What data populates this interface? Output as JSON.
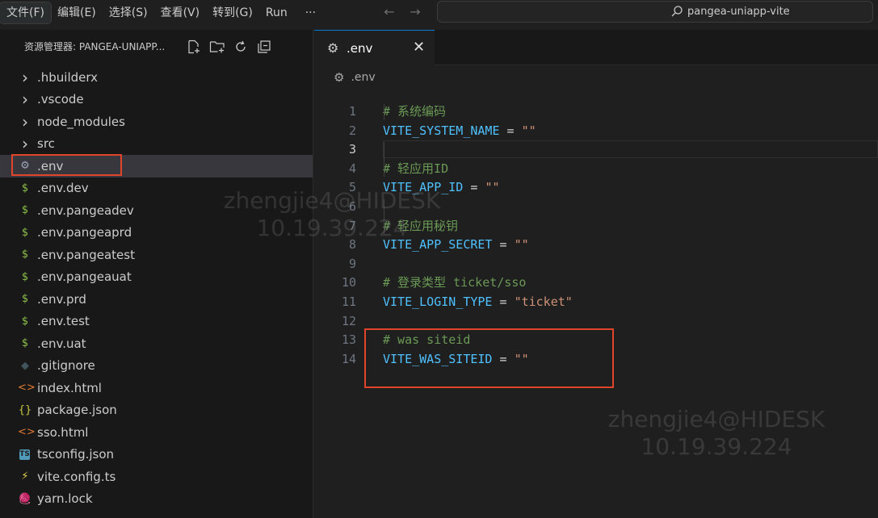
{
  "menu": {
    "items": [
      "文件(F)",
      "编辑(E)",
      "选择(S)",
      "查看(V)",
      "转到(G)",
      "Run"
    ],
    "more": "···"
  },
  "search": {
    "text": "pangea-uniapp-vite"
  },
  "sidebar": {
    "title": "资源管理器: PANGEA-UNIAPP...",
    "files": [
      {
        "label": ".hbuilderx",
        "icon": "chevron-right-icon",
        "glyph": "›",
        "color": "#cccccc"
      },
      {
        "label": ".vscode",
        "icon": "chevron-right-icon",
        "glyph": "›",
        "color": "#cccccc"
      },
      {
        "label": "node_modules",
        "icon": "chevron-right-icon",
        "glyph": "›",
        "color": "#cccccc"
      },
      {
        "label": "src",
        "icon": "chevron-right-icon",
        "glyph": "›",
        "color": "#cccccc"
      },
      {
        "label": ".env",
        "icon": "gear-icon",
        "glyph": "⚙",
        "color": "#9da5b4",
        "selected": true
      },
      {
        "label": ".env.dev",
        "icon": "dollar-icon",
        "glyph": "$",
        "color": "#8dc149"
      },
      {
        "label": ".env.pangeadev",
        "icon": "dollar-icon",
        "glyph": "$",
        "color": "#8dc149"
      },
      {
        "label": ".env.pangeaprd",
        "icon": "dollar-icon",
        "glyph": "$",
        "color": "#8dc149"
      },
      {
        "label": ".env.pangeatest",
        "icon": "dollar-icon",
        "glyph": "$",
        "color": "#8dc149"
      },
      {
        "label": ".env.pangeauat",
        "icon": "dollar-icon",
        "glyph": "$",
        "color": "#8dc149"
      },
      {
        "label": ".env.prd",
        "icon": "dollar-icon",
        "glyph": "$",
        "color": "#8dc149"
      },
      {
        "label": ".env.test",
        "icon": "dollar-icon",
        "glyph": "$",
        "color": "#8dc149"
      },
      {
        "label": ".env.uat",
        "icon": "dollar-icon",
        "glyph": "$",
        "color": "#8dc149"
      },
      {
        "label": ".gitignore",
        "icon": "git-icon",
        "glyph": "◆",
        "color": "#41535b"
      },
      {
        "label": "index.html",
        "icon": "html-icon",
        "glyph": "<>",
        "color": "#e37933"
      },
      {
        "label": "package.json",
        "icon": "json-icon",
        "glyph": "{}",
        "color": "#cbcb41"
      },
      {
        "label": "sso.html",
        "icon": "html-icon",
        "glyph": "<>",
        "color": "#e37933"
      },
      {
        "label": "tsconfig.json",
        "icon": "typescript-icon",
        "glyph": "TS",
        "color": "#519aba"
      },
      {
        "label": "vite.config.ts",
        "icon": "vite-icon",
        "glyph": "⚡",
        "color": "#e8d44d"
      },
      {
        "label": "yarn.lock",
        "icon": "yarn-icon",
        "glyph": "🧶",
        "color": "#519aba"
      }
    ]
  },
  "editor": {
    "tab_label": ".env",
    "tab_close": "✕",
    "breadcrumb": ".env",
    "current_line": 3,
    "lines": [
      {
        "n": "1",
        "parts": [
          [
            "cm",
            "# 系统编码"
          ]
        ]
      },
      {
        "n": "2",
        "parts": [
          [
            "var",
            "VITE_SYSTEM_NAME"
          ],
          [
            "op",
            " = "
          ],
          [
            "str",
            "\"\""
          ]
        ]
      },
      {
        "n": "3",
        "parts": []
      },
      {
        "n": "4",
        "parts": [
          [
            "cm",
            "# 轻应用ID"
          ]
        ]
      },
      {
        "n": "5",
        "parts": [
          [
            "var",
            "VITE_APP_ID"
          ],
          [
            "op",
            " = "
          ],
          [
            "str",
            "\"\""
          ]
        ]
      },
      {
        "n": "6",
        "parts": []
      },
      {
        "n": "7",
        "parts": [
          [
            "cm",
            "# 轻应用秘钥"
          ]
        ]
      },
      {
        "n": "8",
        "parts": [
          [
            "var",
            "VITE_APP_SECRET"
          ],
          [
            "op",
            " = "
          ],
          [
            "str",
            "\"\""
          ]
        ]
      },
      {
        "n": "9",
        "parts": []
      },
      {
        "n": "10",
        "parts": [
          [
            "cm",
            "# 登录类型 ticket/sso"
          ]
        ]
      },
      {
        "n": "11",
        "parts": [
          [
            "var",
            "VITE_LOGIN_TYPE"
          ],
          [
            "op",
            " = "
          ],
          [
            "str",
            "\"ticket\""
          ]
        ]
      },
      {
        "n": "12",
        "parts": []
      },
      {
        "n": "13",
        "parts": [
          [
            "cm",
            "# was siteid"
          ]
        ]
      },
      {
        "n": "14",
        "parts": [
          [
            "var",
            "VITE_WAS_SITEID"
          ],
          [
            "op",
            " = "
          ],
          [
            "str",
            "\"\""
          ]
        ]
      }
    ]
  },
  "watermark": {
    "line1": "zhengjie4@HIDESK",
    "line2": "10.19.39.224"
  },
  "colors": {
    "highlight_box": "#e0442a",
    "accent": "#0078d4"
  }
}
